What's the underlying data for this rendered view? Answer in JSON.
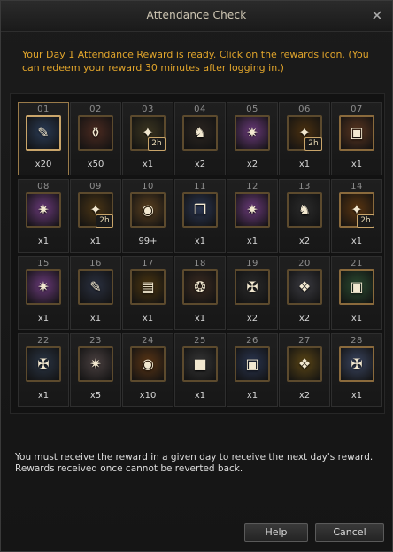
{
  "window": {
    "title": "Attendance Check",
    "close_glyph": "✕"
  },
  "message_top": "Your Day 1 Attendance Reward is ready. Click on the rewards icon. (You can redeem your reward 30 minutes after logging in.)",
  "message_bottom": "You must receive the reward in a given day to receive the next day's reward. Rewards received once cannot be reverted back.",
  "buttons": {
    "help": "Help",
    "cancel": "Cancel"
  },
  "colors": {
    "accent_text": "#e0a42b",
    "current_day_border": "#c9a56a"
  },
  "days": [
    {
      "day": "01",
      "qty": "x20",
      "icon": "scroll-icon",
      "bg": "#2a3b55",
      "current": true
    },
    {
      "day": "02",
      "qty": "x50",
      "icon": "potion-icon",
      "bg": "#4b2a20"
    },
    {
      "day": "03",
      "qty": "x1",
      "icon": "buff-icon",
      "bg": "#3b3520",
      "badge": "2h"
    },
    {
      "day": "04",
      "qty": "x2",
      "icon": "knight-icon",
      "bg": "#2b2520"
    },
    {
      "day": "05",
      "qty": "x2",
      "icon": "rune-icon",
      "bg": "#6a3a7a"
    },
    {
      "day": "06",
      "qty": "x1",
      "icon": "buff-icon",
      "bg": "#4a3010",
      "badge": "2h"
    },
    {
      "day": "07",
      "qty": "x1",
      "icon": "chest-icon",
      "bg": "#5a3520",
      "special": true
    },
    {
      "day": "08",
      "qty": "x1",
      "icon": "rune-icon",
      "bg": "#6a3a7a"
    },
    {
      "day": "09",
      "qty": "x1",
      "icon": "buff-icon",
      "bg": "#4a3515",
      "badge": "2h"
    },
    {
      "day": "10",
      "qty": "99+",
      "icon": "coin-icon",
      "bg": "#5a4020"
    },
    {
      "day": "11",
      "qty": "x1",
      "icon": "book-icon",
      "bg": "#2a3550"
    },
    {
      "day": "12",
      "qty": "x1",
      "icon": "rune-icon",
      "bg": "#6a3a7a"
    },
    {
      "day": "13",
      "qty": "x2",
      "icon": "knight-icon",
      "bg": "#2a2a2a"
    },
    {
      "day": "14",
      "qty": "x1",
      "icon": "buff-icon",
      "bg": "#5a3510",
      "badge": "2h",
      "special": true
    },
    {
      "day": "15",
      "qty": "x1",
      "icon": "rune-icon",
      "bg": "#6a3a7a"
    },
    {
      "day": "16",
      "qty": "x1",
      "icon": "scroll-icon",
      "bg": "#2a3040"
    },
    {
      "day": "17",
      "qty": "x1",
      "icon": "tome-icon",
      "bg": "#4a3510"
    },
    {
      "day": "18",
      "qty": "x1",
      "icon": "sigil-icon",
      "bg": "#3a2a20"
    },
    {
      "day": "19",
      "qty": "x2",
      "icon": "cross-icon",
      "bg": "#2a2a2a"
    },
    {
      "day": "20",
      "qty": "x2",
      "icon": "crystal-icon",
      "bg": "#3a3a40"
    },
    {
      "day": "21",
      "qty": "x1",
      "icon": "chest-icon",
      "bg": "#2a4a30",
      "special": true
    },
    {
      "day": "22",
      "qty": "x1",
      "icon": "cross-icon",
      "bg": "#2a3545"
    },
    {
      "day": "23",
      "qty": "x5",
      "icon": "rune-icon",
      "bg": "#4a4040"
    },
    {
      "day": "24",
      "qty": "x10",
      "icon": "coin-icon",
      "bg": "#5a3515"
    },
    {
      "day": "25",
      "qty": "x1",
      "icon": "block-icon",
      "bg": "#353535"
    },
    {
      "day": "26",
      "qty": "x1",
      "icon": "chest-icon",
      "bg": "#2a3550"
    },
    {
      "day": "27",
      "qty": "x2",
      "icon": "crystal-icon",
      "bg": "#5a4515"
    },
    {
      "day": "28",
      "qty": "x1",
      "icon": "cross-icon",
      "bg": "#3a4560",
      "special": true
    }
  ]
}
